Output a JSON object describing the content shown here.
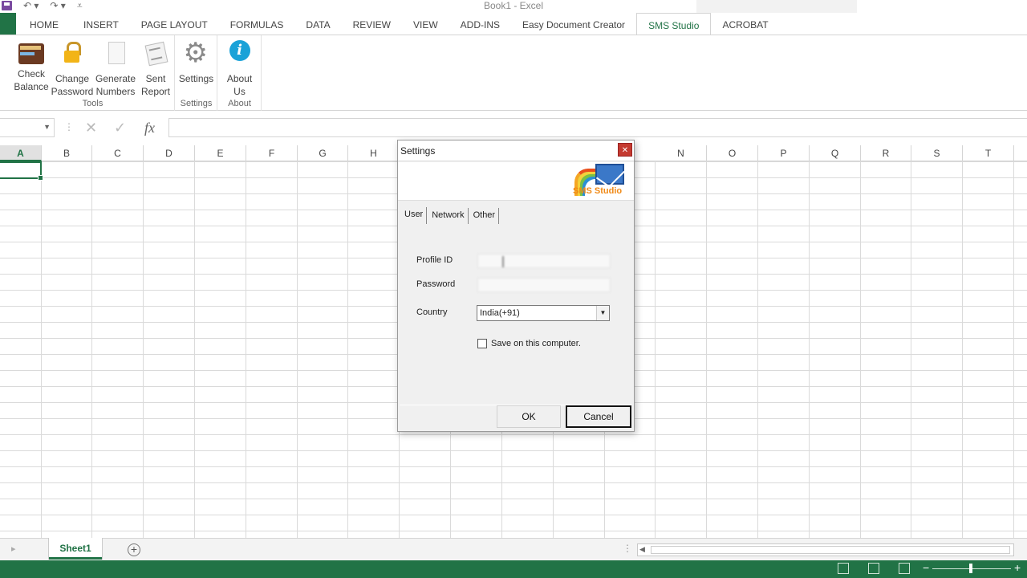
{
  "window": {
    "title": "Book1 - Excel"
  },
  "quick_access": {
    "save_icon": "save-icon",
    "undo_icon": "undo-icon",
    "redo_icon": "redo-icon",
    "customize_icon": "customize-qat-icon"
  },
  "ribbon": {
    "tabs": [
      "HOME",
      "INSERT",
      "PAGE LAYOUT",
      "FORMULAS",
      "DATA",
      "REVIEW",
      "VIEW",
      "ADD-INS",
      "Easy Document Creator",
      "SMS Studio",
      "ACROBAT"
    ],
    "active_tab": "SMS Studio",
    "groups": [
      {
        "label": "Tools",
        "buttons": [
          {
            "line1": "Check",
            "line2": "Balance",
            "icon": "wallet-icon"
          },
          {
            "line1": "Change",
            "line2": "Password",
            "icon": "lock-icon"
          },
          {
            "line1": "Generate",
            "line2": "Numbers",
            "icon": "document-icon"
          },
          {
            "line1": "Sent",
            "line2": "Report",
            "icon": "report-icon"
          }
        ]
      },
      {
        "label": "Settings",
        "buttons": [
          {
            "line1": "Settings",
            "line2": "",
            "icon": "gear-icon"
          }
        ]
      },
      {
        "label": "About",
        "buttons": [
          {
            "line1": "About",
            "line2": "Us",
            "icon": "info-icon"
          }
        ]
      }
    ]
  },
  "formula_bar": {
    "name_box": "",
    "fx": "fx",
    "content": ""
  },
  "grid": {
    "columns": [
      "A",
      "B",
      "C",
      "D",
      "E",
      "F",
      "G",
      "H",
      "N",
      "O",
      "P",
      "Q",
      "R",
      "S",
      "T"
    ],
    "selected_column": "A"
  },
  "sheets": {
    "tabs": [
      "Sheet1"
    ],
    "active": "Sheet1"
  },
  "dialog": {
    "title": "Settings",
    "logo_text": "SMS Studio",
    "tabs": [
      "User",
      "Network",
      "Other"
    ],
    "active_tab": "User",
    "fields": {
      "profile_id_label": "Profile ID",
      "password_label": "Password",
      "country_label": "Country",
      "country_value": "India(+91)",
      "save_checkbox_label": "Save on this computer.",
      "save_checked": false
    },
    "buttons": {
      "ok": "OK",
      "cancel": "Cancel"
    },
    "colors": {
      "close": "#c43a30",
      "logo_text": "#f08a17"
    }
  },
  "colors": {
    "excel_green": "#217346"
  }
}
